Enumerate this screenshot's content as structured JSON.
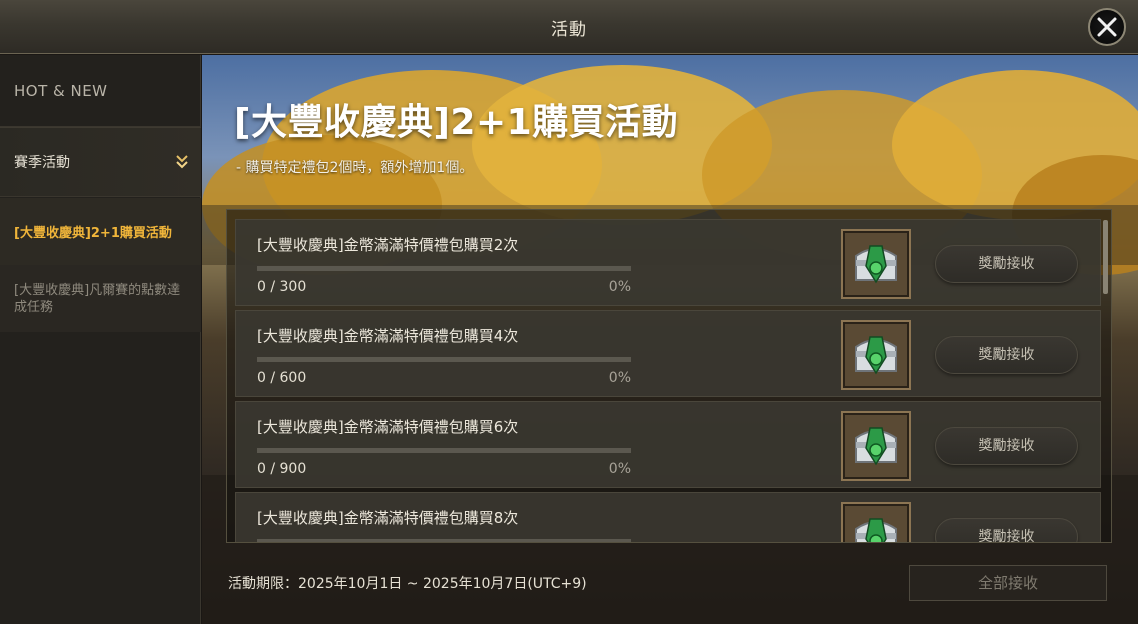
{
  "window": {
    "title": "活動"
  },
  "sidebar": {
    "items": [
      {
        "label": "HOT & NEW"
      },
      {
        "label": "賽季活動"
      },
      {
        "label": "[大豐收慶典]2+1購買活動"
      },
      {
        "label": "[大豐收慶典]凡爾賽的點數達成任務"
      }
    ]
  },
  "event": {
    "title": "[大豐收慶典]2+1購買活動",
    "description": "- 購買特定禮包2個時，額外增加1個。",
    "period": "活動期限：2025年10月1日 ~ 2025年10月7日(UTC+9)",
    "claim_all_label": "全部接收"
  },
  "missions": [
    {
      "name": "[大豐收慶典]金幣滿滿特價禮包購買2次",
      "count": "0 / 300",
      "percent": "0%",
      "progress": 0,
      "button": "獎勵接收",
      "reward_icon": "silver-chest-icon"
    },
    {
      "name": "[大豐收慶典]金幣滿滿特價禮包購買4次",
      "count": "0 / 600",
      "percent": "0%",
      "progress": 0,
      "button": "獎勵接收",
      "reward_icon": "silver-chest-icon"
    },
    {
      "name": "[大豐收慶典]金幣滿滿特價禮包購買6次",
      "count": "0 / 900",
      "percent": "0%",
      "progress": 0,
      "button": "獎勵接收",
      "reward_icon": "silver-chest-icon"
    },
    {
      "name": "[大豐收慶典]金幣滿滿特價禮包購買8次",
      "button": "獎勵接收",
      "reward_icon": "silver-chest-icon"
    }
  ],
  "colors": {
    "active_tab": "#f0b53a",
    "progress_fill": "#c9a24a"
  }
}
